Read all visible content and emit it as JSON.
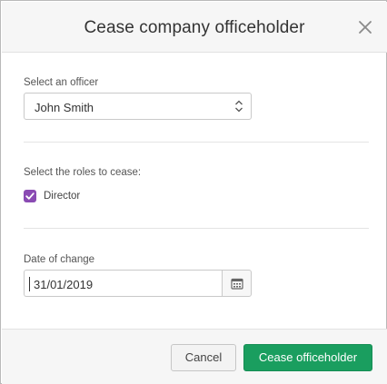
{
  "dialog": {
    "title": "Cease company officeholder"
  },
  "officer": {
    "label": "Select an officer",
    "selected": "John Smith"
  },
  "roles": {
    "label": "Select the roles to cease:",
    "items": [
      {
        "label": "Director",
        "checked": true
      }
    ]
  },
  "date": {
    "label": "Date of change",
    "value": "31/01/2019"
  },
  "footer": {
    "cancel_label": "Cancel",
    "confirm_label": "Cease officeholder"
  },
  "colors": {
    "accent_green": "#1a9e5f",
    "checkbox_purple": "#8a4bb3"
  }
}
